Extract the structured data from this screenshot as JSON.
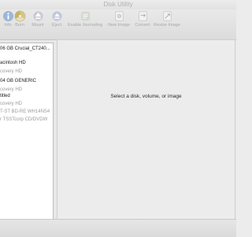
{
  "window": {
    "title": "Disk Utility"
  },
  "toolbar": {
    "items": [
      {
        "label": "Info",
        "icon": "info-icon"
      },
      {
        "label": "Burn",
        "icon": "burn-icon"
      },
      {
        "label": "Mount",
        "icon": "mount-icon"
      },
      {
        "label": "Eject",
        "icon": "eject-icon"
      },
      {
        "label": "Enable Journaling",
        "icon": "journaling-icon"
      },
      {
        "label": "New Image",
        "icon": "new-image-icon"
      },
      {
        "label": "Convert",
        "icon": "convert-icon"
      },
      {
        "label": "Resize Image",
        "icon": "resize-image-icon"
      }
    ]
  },
  "sidebar": {
    "items": [
      {
        "label": "06 GB Crucial_CT240..."
      },
      {
        "label": "acintosh HD"
      },
      {
        "label": "covery HD"
      },
      {
        "label": "04 GB GENERIC"
      },
      {
        "label": "covery HD"
      },
      {
        "label": "titled"
      },
      {
        "label": "covery HD"
      },
      {
        "label": "T-ST BD-RE WH14NS4"
      },
      {
        "label": "r TSSTcorp CD/DVDW"
      }
    ]
  },
  "content": {
    "placeholder": "Select a disk, volume, or image"
  }
}
